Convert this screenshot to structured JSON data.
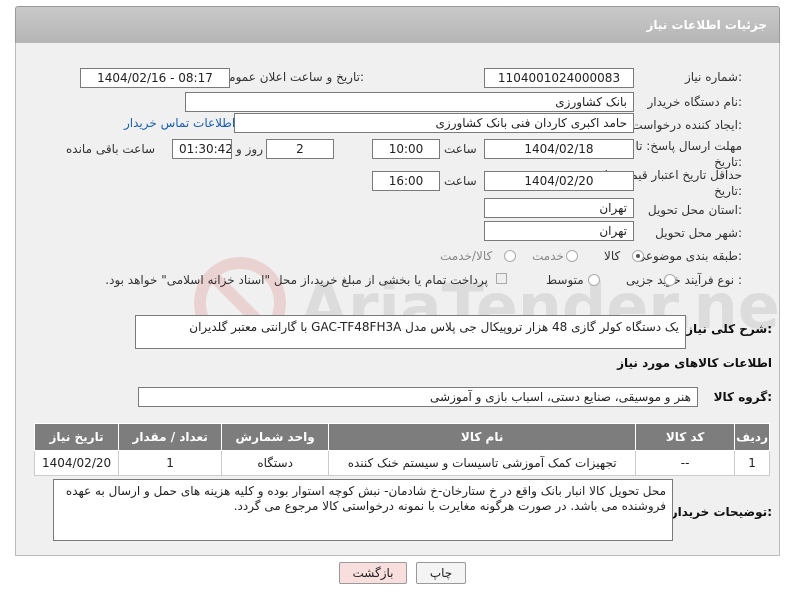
{
  "header": {
    "title": "جزئیات اطلاعات نیاز"
  },
  "form": {
    "need_number_label": "شماره نیاز:",
    "need_number": "1104001024000083",
    "announce_label": "تاریخ و ساعت اعلان عمومی:",
    "announce_value": "1404/02/16 - 08:17",
    "buyer_org_label": "نام دستگاه خریدار:",
    "buyer_org": "بانک کشاورزی",
    "creator_label": "ایجاد کننده درخواست:",
    "creator": "حامد اکبری کاردان فنی بانک کشاورزی",
    "contact_link": "اطلاعات تماس خریدار",
    "deadline_label": "مهلت ارسال پاسخ: تا تاریخ:",
    "deadline_date": "1404/02/18",
    "time_label": "ساعت",
    "deadline_time": "10:00",
    "days_value": "2",
    "days_label": "روز و",
    "remaining_time": "01:30:42",
    "remaining_label": "ساعت باقی مانده",
    "validity_label": "حداقل تاریخ اعتبار قیمت: تا تاریخ:",
    "validity_date": "1404/02/20",
    "validity_time_label": "ساعت",
    "validity_time": "16:00",
    "province_label": "استان محل تحویل:",
    "province": "تهران",
    "city_label": "شهر محل تحویل:",
    "city": "تهران",
    "category_label": "طبقه بندی موضوعی:",
    "category_options": [
      "کالا",
      "خدمت",
      "کالا/خدمت"
    ],
    "purchase_type_label": "نوع فرآیند خرید :",
    "purchase_options": [
      "جزیی",
      "متوسط"
    ],
    "treasury_note": "پرداخت تمام یا بخشی از مبلغ خرید،از محل \"اسناد خزانه اسلامی\" خواهد بود."
  },
  "description": {
    "label": "شرح کلی نیاز:",
    "text": "یک دستگاه کولر گازی 48 هزار تروپیکال جی پلاس مدل GAC-TF48FH3A با گارانتی معتبر گلدیران"
  },
  "goods": {
    "section_title": "اطلاعات کالاهای مورد نیاز",
    "group_label": "گروه کالا:",
    "group_value": "هنر و موسیقی، صنایع دستی، اسباب بازی و آموزشی",
    "columns": [
      "ردیف",
      "کد کالا",
      "نام کالا",
      "واحد شمارش",
      "تعداد / مقدار",
      "تاریخ نیاز"
    ],
    "rows": [
      [
        "1",
        "--",
        "تجهیزات کمک آموزشی تاسیسات و سیستم خنک کننده",
        "دستگاه",
        "1",
        "1404/02/20"
      ]
    ]
  },
  "buyer_notes": {
    "label": "توضیحات خریدار:",
    "text": "محل تحویل کالا انبار بانک واقع در خ ستارخان-خ شادمان- نبش کوچه استوار بوده و کلیه هزینه های حمل و ارسال به عهده فروشنده می باشد. در صورت هرگونه مغایرت با نمونه درخواستی کالا مرجوع می گردد."
  },
  "buttons": {
    "print": "چاپ",
    "back": "بازگشت"
  },
  "colors": {
    "header_bg": "#bdbdbd",
    "table_head": "#7d7d7d",
    "back_btn": "#f9dede",
    "link": "#1a5fb4"
  },
  "watermark": {
    "text": "AriaTender.net"
  }
}
